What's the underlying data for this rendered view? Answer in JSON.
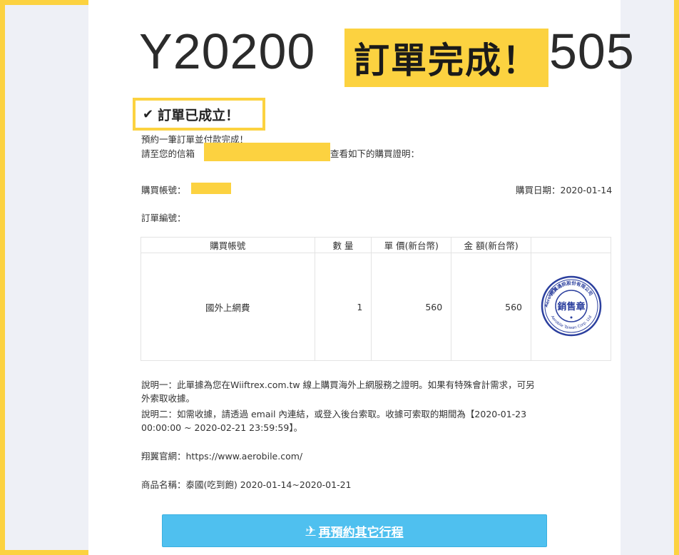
{
  "header": {
    "order_id_left": "Y20200",
    "order_id_right": "505",
    "banner": "訂單完成！"
  },
  "status": {
    "created_label": "訂單已成立！"
  },
  "intro": {
    "line1": "預約一筆訂單並付款完成！",
    "line2_prefix": "請至您的信箱",
    "line2_suffix": "查看如下的購買證明："
  },
  "meta": {
    "account_label": "購買帳號：",
    "purchase_date": "購買日期：2020-01-14",
    "order_no_label": "訂單編號："
  },
  "table": {
    "headers": [
      "購買帳號",
      "數 量",
      "單 價(新台幣)",
      "金 額(新台幣)",
      ""
    ],
    "rows": [
      {
        "item": "國外上網費",
        "qty": "1",
        "unit_price": "560",
        "amount": "560"
      }
    ]
  },
  "stamp": {
    "center_text": "銷售章",
    "ring_top": "翔翼通訊股份有限公司",
    "ring_brand": "Aerobile",
    "ring_bottom": "Aerobile Taiwan Corp. Ltd"
  },
  "notes": {
    "note1_line1": "說明一：此單據為您在Wiiftrex.com.tw 線上購買海外上網服務之證明。如果有特殊會計需求，可另",
    "note1_line2": "外索取收據。",
    "note2_line1": "說明二：如需收據，請透過 email 內連結，或登入後台索取。收據可索取的期間為【2020-01-23",
    "note2_line2": "00:00:00 ~ 2020-02-21 23:59:59】。",
    "website": "翔翼官網：https://www.aerobile.com/",
    "product": "商品名稱：泰國(吃到飽) 2020-01-14~2020-01-21"
  },
  "cta": {
    "label": "再預約其它行程"
  },
  "colors": {
    "highlight": "#fcd240",
    "cta": "#4fc0ef",
    "stamp": "#2b3f9e"
  }
}
